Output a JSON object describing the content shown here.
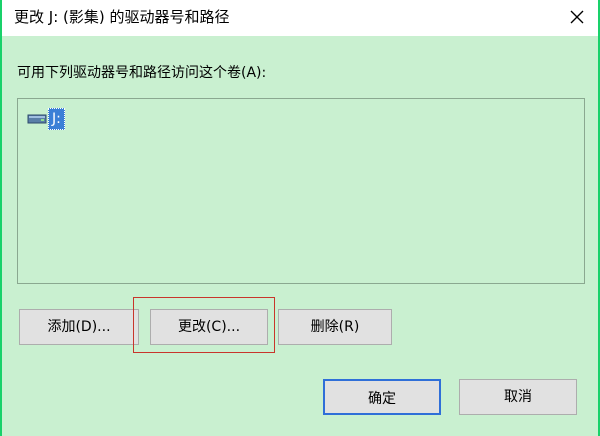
{
  "dialog": {
    "title": "更改 J: (影集) 的驱动器号和路径",
    "prompt": "可用下列驱动器号和路径访问这个卷(A):",
    "drives": [
      {
        "label": "J:",
        "icon": "drive-icon",
        "selected": true
      }
    ],
    "buttons": {
      "add": "添加(D)...",
      "change": "更改(C)...",
      "delete": "删除(R)",
      "ok": "确定",
      "cancel": "取消"
    }
  },
  "colors": {
    "frame": "#19d16a",
    "content_bg": "#c9f0d0",
    "selection": "#3b7fd6",
    "highlight": "#c8352b",
    "default_button_border": "#2f6fd8"
  }
}
